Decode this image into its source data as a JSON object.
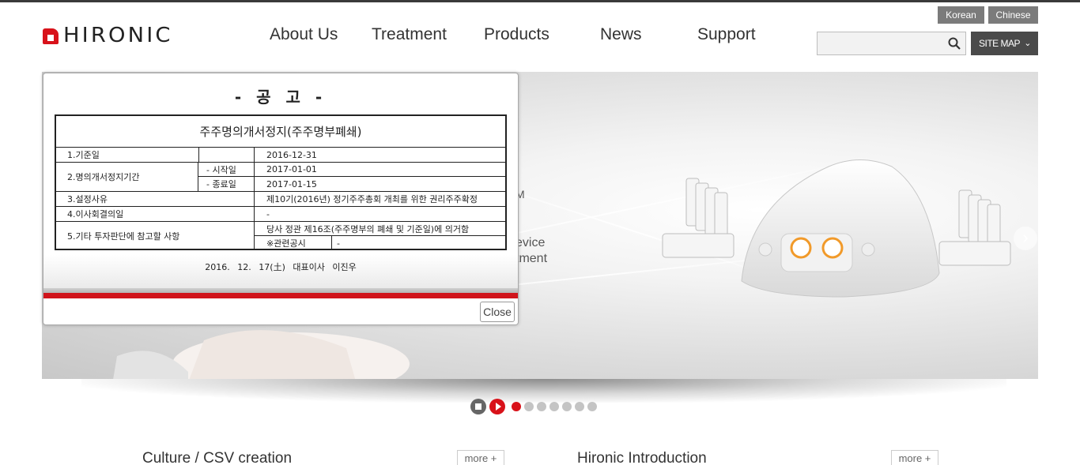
{
  "header": {
    "logo_text": "HIRONIC",
    "nav": [
      {
        "label": "About Us"
      },
      {
        "label": "Treatment"
      },
      {
        "label": "Products"
      },
      {
        "label": "News"
      },
      {
        "label": "Support"
      }
    ],
    "languages": [
      "Korean",
      "Chinese"
    ],
    "search": {
      "value": "",
      "placeholder": ""
    },
    "sitemap_label": "SITE MAP"
  },
  "banner": {
    "partial_text": [
      "M",
      "evice",
      "tment"
    ],
    "slides_total": 7,
    "active_slide": 1
  },
  "popup": {
    "heading": "- 공 고 -",
    "notice_title": "주주명의개서정지(주주명부폐쇄)",
    "rows": [
      {
        "label": "1.기준일",
        "sub": "",
        "value": "2016-12-31"
      },
      {
        "label": "2.명의개서정지기간",
        "sub": "- 시작일",
        "value": "2017-01-01"
      },
      {
        "label": "",
        "sub": "- 종료일",
        "value": "2017-01-15"
      },
      {
        "label": "3.설정사유",
        "sub": "",
        "value": "제10기(2016년) 정기주주총회 개최를 위한 권리주주확정"
      },
      {
        "label": "4.이사회결의일",
        "sub": "",
        "value": "-"
      },
      {
        "label": "5.기타 투자판단에 참고할 사항",
        "sub": "",
        "value": "당사 정관 제16조(주주명부의 폐쇄 및 기준일)에 의거함"
      },
      {
        "label": "",
        "sub": "",
        "value": "※관련공시",
        "value2": "-"
      }
    ],
    "signature": "2016. 12. 17(土)  대표이사 이진우",
    "close_label": "Close"
  },
  "sections": [
    {
      "title": "Culture / CSV creation",
      "more": "more +"
    },
    {
      "title": "Hironic Introduction",
      "more": "more +"
    }
  ],
  "colors": {
    "brand_red": "#d8121a",
    "nav_text": "#333333",
    "button_grey": "#7b7b7b",
    "sitemap_bg": "#4a4a4a"
  }
}
